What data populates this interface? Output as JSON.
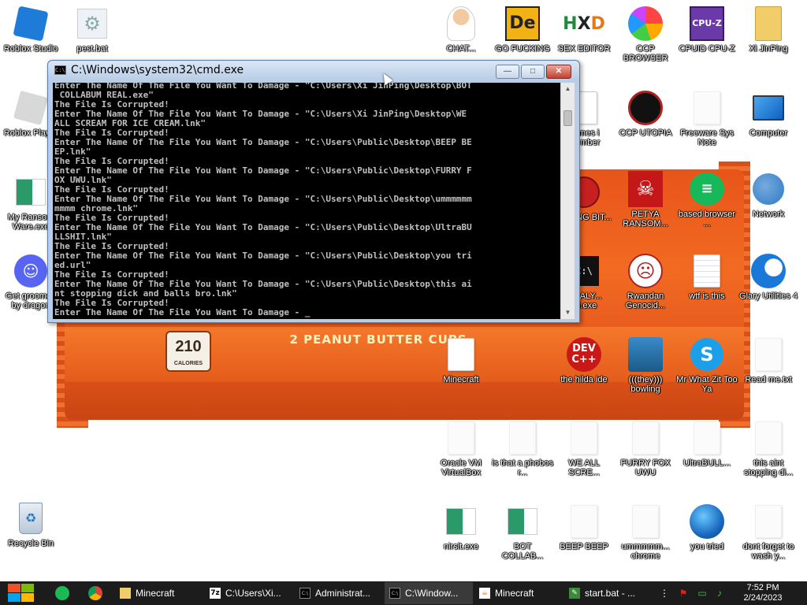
{
  "desktop": {
    "icons": [
      {
        "label": "Roblox Studio"
      },
      {
        "label": "pest.bat"
      },
      {
        "label": "Roblox Player"
      },
      {
        "label": "My Ransom Ware.exe"
      },
      {
        "label": "Get groomed by dragon"
      },
      {
        "label": "Recycle Bin"
      },
      {
        "label": "CHAT..."
      },
      {
        "label": "GO FUCKING"
      },
      {
        "label": "SEX EDITOR"
      },
      {
        "label": "CCP BROWSER"
      },
      {
        "label": "CPUID CPU-Z"
      },
      {
        "label": "Xi JinPing"
      },
      {
        "label": "games i member"
      },
      {
        "label": "CCP UTOPIA"
      },
      {
        "label": "Freeware Sys Note"
      },
      {
        "label": "Computer"
      },
      {
        "label": "BAKING BIT..."
      },
      {
        "label": "PETYA RANSOM..."
      },
      {
        "label": "based browser ..."
      },
      {
        "label": "Network"
      },
      {
        "label": "...CALY... ...i.exe"
      },
      {
        "label": "Rwandan Genocid..."
      },
      {
        "label": "wtf is this"
      },
      {
        "label": "Glary Utilities 4"
      },
      {
        "label": "Minecraft"
      },
      {
        "label": "the hilda ide"
      },
      {
        "label": "(((they))) bowling"
      },
      {
        "label": "Mr What Zit Too Ya"
      },
      {
        "label": "Read me.txt"
      },
      {
        "label": "Oracle VM VirtualBox"
      },
      {
        "label": "is that a phobos r..."
      },
      {
        "label": "WE ALL SCRE..."
      },
      {
        "label": "FURRY FOX UWU"
      },
      {
        "label": "UltraBULL..."
      },
      {
        "label": "this aint stopping di..."
      },
      {
        "label": "nirsit.exe"
      },
      {
        "label": "BOT COLLAB..."
      },
      {
        "label": "BEEP BEEP"
      },
      {
        "label": "ummmmm... chrome"
      },
      {
        "label": "you tried"
      },
      {
        "label": "dont forget to wash y..."
      }
    ]
  },
  "wallpaper": {
    "band_text": "2 PEANUT BUTTER CUPS",
    "badge_number": "210",
    "badge_unit": "CALORIES"
  },
  "cmd_window": {
    "title": "C:\\Windows\\system32\\cmd.exe",
    "buttons": {
      "minimize": "—",
      "maximize": "□",
      "close": "✕"
    },
    "lines": [
      "Enter The Name Of The File You Want To Damage - \"C:\\Users\\Xi JinPing\\Desktop\\BOT",
      " COLLABUM REAL.exe\"",
      "The File Is Corrupted!",
      "Enter The Name Of The File You Want To Damage - \"C:\\Users\\Xi JinPing\\Desktop\\WE",
      "ALL SCREAM FOR ICE CREAM.lnk\"",
      "The File Is Corrupted!",
      "Enter The Name Of The File You Want To Damage - \"C:\\Users\\Public\\Desktop\\BEEP BE",
      "EP.lnk\"",
      "The File Is Corrupted!",
      "Enter The Name Of The File You Want To Damage - \"C:\\Users\\Public\\Desktop\\FURRY F",
      "OX UWU.lnk\"",
      "The File Is Corrupted!",
      "Enter The Name Of The File You Want To Damage - \"C:\\Users\\Public\\Desktop\\ummmmmm",
      "mmmm chrome.lnk\"",
      "The File Is Corrupted!",
      "Enter The Name Of The File You Want To Damage - \"C:\\Users\\Public\\Desktop\\UltraBU",
      "LLSHIT.lnk\"",
      "The File Is Corrupted!",
      "Enter The Name Of The File You Want To Damage - \"C:\\Users\\Public\\Desktop\\you tri",
      "ed.url\"",
      "The File Is Corrupted!",
      "Enter The Name Of The File You Want To Damage - \"C:\\Users\\Public\\Desktop\\this ai",
      "nt stopping dick and balls bro.lnk\"",
      "The File Is Corrupted!",
      "Enter The Name Of The File You Want To Damage - _"
    ]
  },
  "taskbar": {
    "items": [
      {
        "label": "Minecraft",
        "icon": "folder-icon"
      },
      {
        "label": "C:\\Users\\Xi...",
        "icon": "7zip-icon"
      },
      {
        "label": "Administrat...",
        "icon": "cmd-icon"
      },
      {
        "label": "C:\\Window...",
        "icon": "cmd-icon"
      },
      {
        "label": "Minecraft",
        "icon": "java-icon"
      },
      {
        "label": "start.bat - ...",
        "icon": "notepadpp-icon"
      }
    ],
    "clock_time": "7:52 PM",
    "clock_date": "2/24/2023"
  },
  "colors": {
    "taskbar": "#1c1c1c",
    "console_bg": "#000000",
    "console_text": "#c0c0c0",
    "wrapper_orange": "#e8541a"
  }
}
